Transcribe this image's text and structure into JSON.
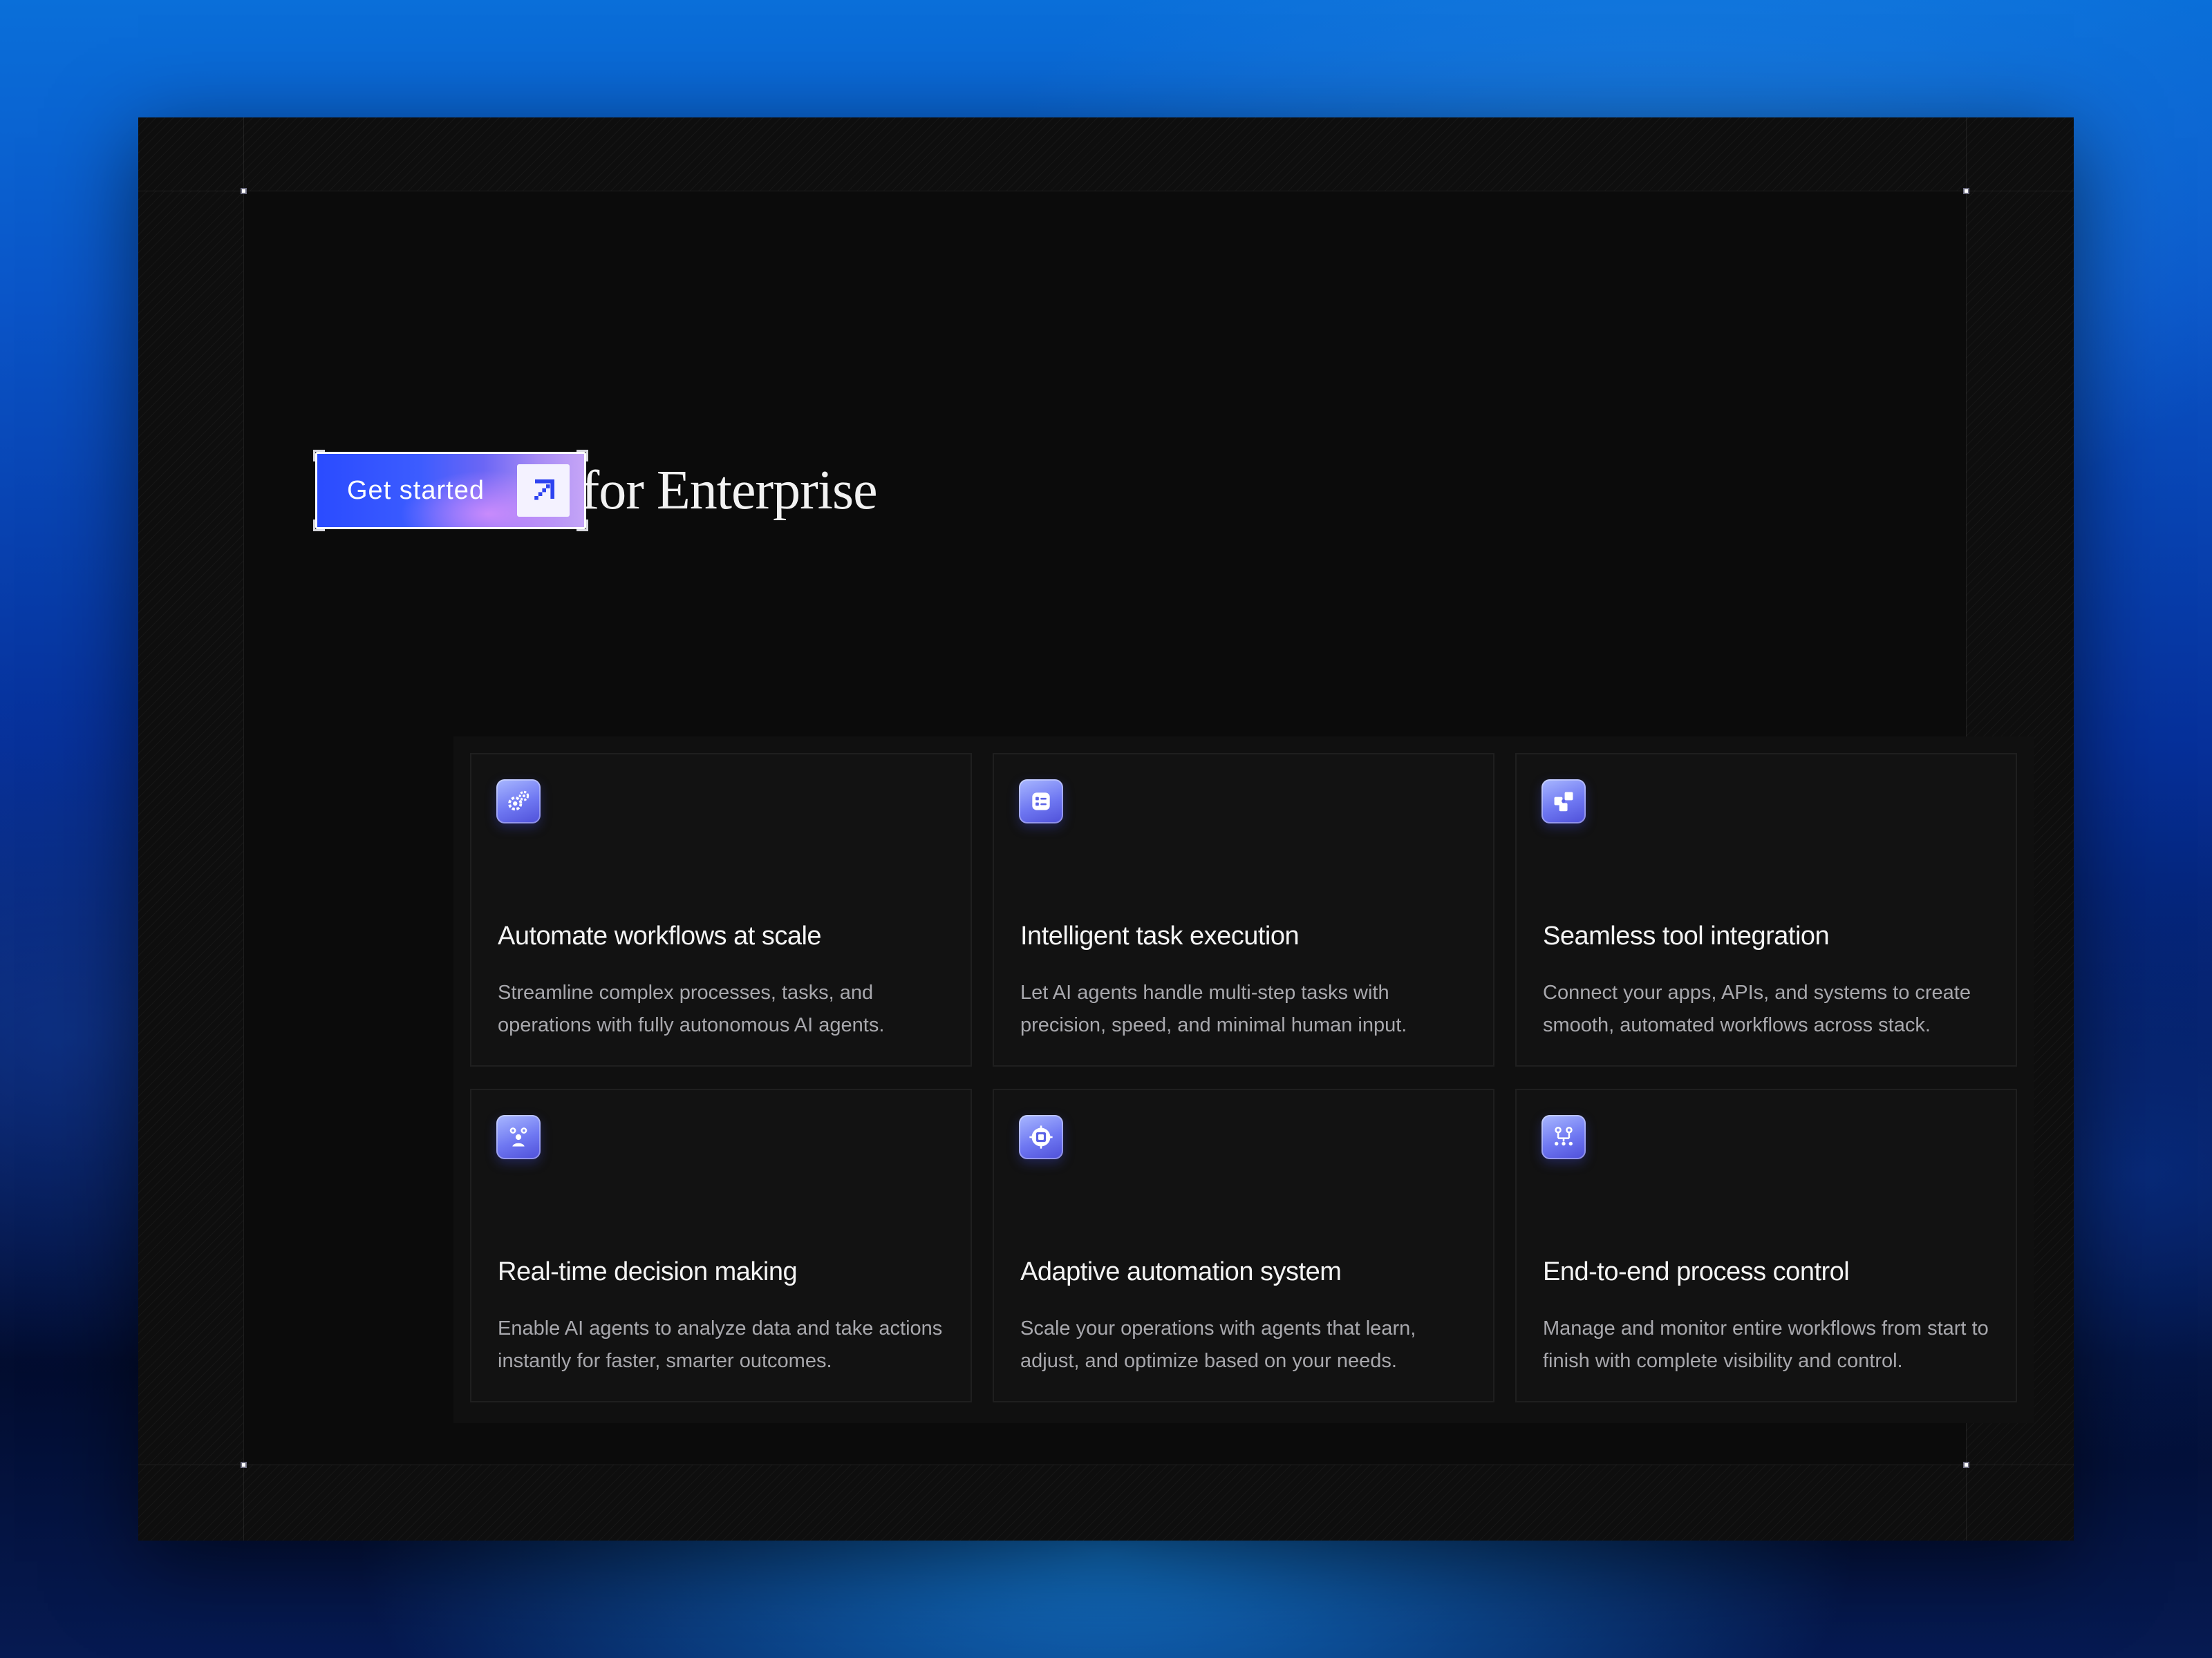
{
  "hero": {
    "title": "AI Agents for Enterprise",
    "cta_label": "Get started",
    "cta_icon": "arrow-up-right-icon"
  },
  "colors": {
    "accent_blue": "#2a4bff",
    "accent_violet": "#c7a6f7",
    "card_background": "#121212",
    "panel_background": "#101010",
    "title_text": "#f4f4f4",
    "body_text": "#a8a8ad"
  },
  "features": [
    {
      "icon": "gears-icon",
      "title": "Automate workflows at scale",
      "description": "Streamline complex processes, tasks, and operations with fully autonomous AI agents."
    },
    {
      "icon": "task-list-icon",
      "title": "Intelligent task execution",
      "description": "Let AI agents handle multi-step tasks with precision, speed, and minimal human input."
    },
    {
      "icon": "puzzle-integration-icon",
      "title": "Seamless tool integration",
      "description": "Connect your apps, APIs, and systems to create smooth, automated workflows across stack."
    },
    {
      "icon": "person-decision-icon",
      "title": "Real-time decision making",
      "description": "Enable AI agents to analyze data and take actions instantly for faster, smarter outcomes."
    },
    {
      "icon": "chip-icon",
      "title": "Adaptive automation system",
      "description": "Scale your operations with agents that learn, adjust, and optimize based on your needs."
    },
    {
      "icon": "process-flow-icon",
      "title": "End-to-end process control",
      "description": "Manage and monitor entire workflows from start to finish with complete visibility and control."
    }
  ]
}
